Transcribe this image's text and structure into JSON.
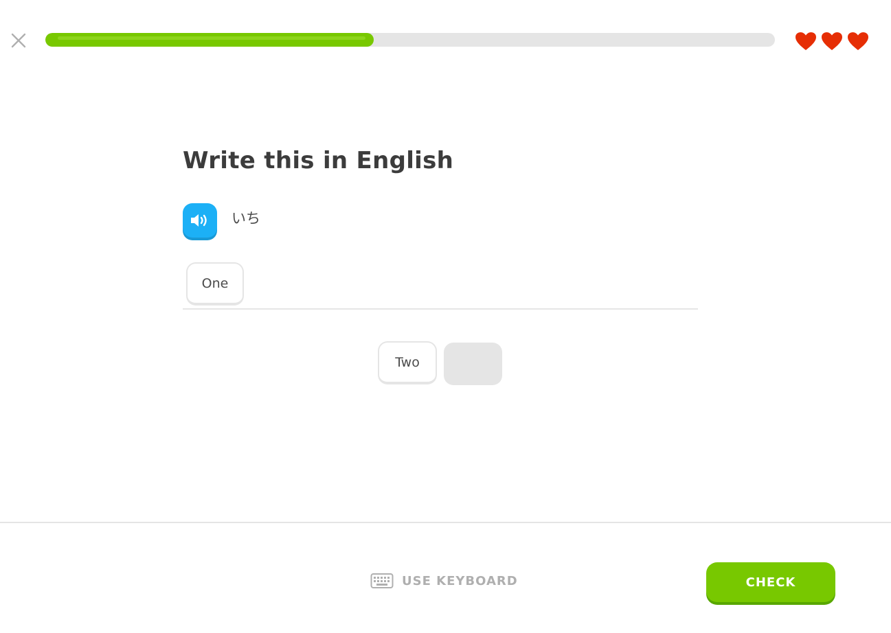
{
  "header": {
    "close_icon": "close-icon",
    "progress": {
      "fraction": 0.45,
      "color": "#78c800",
      "track_color": "#e5e5e5"
    },
    "hearts": {
      "count": 3,
      "icon": "heart-icon",
      "color": "#e62e05"
    }
  },
  "challenge": {
    "title": "Write this in English",
    "audio_icon": "speaker-icon",
    "audio_color": "#1cb0f6",
    "prompt": "いち",
    "answer_tokens": [
      "One"
    ],
    "word_bank": [
      "Two"
    ]
  },
  "footer": {
    "keyboard_icon": "keyboard-icon",
    "keyboard_label": "USE KEYBOARD",
    "check_label": "CHECK",
    "check_color": "#78c800"
  }
}
